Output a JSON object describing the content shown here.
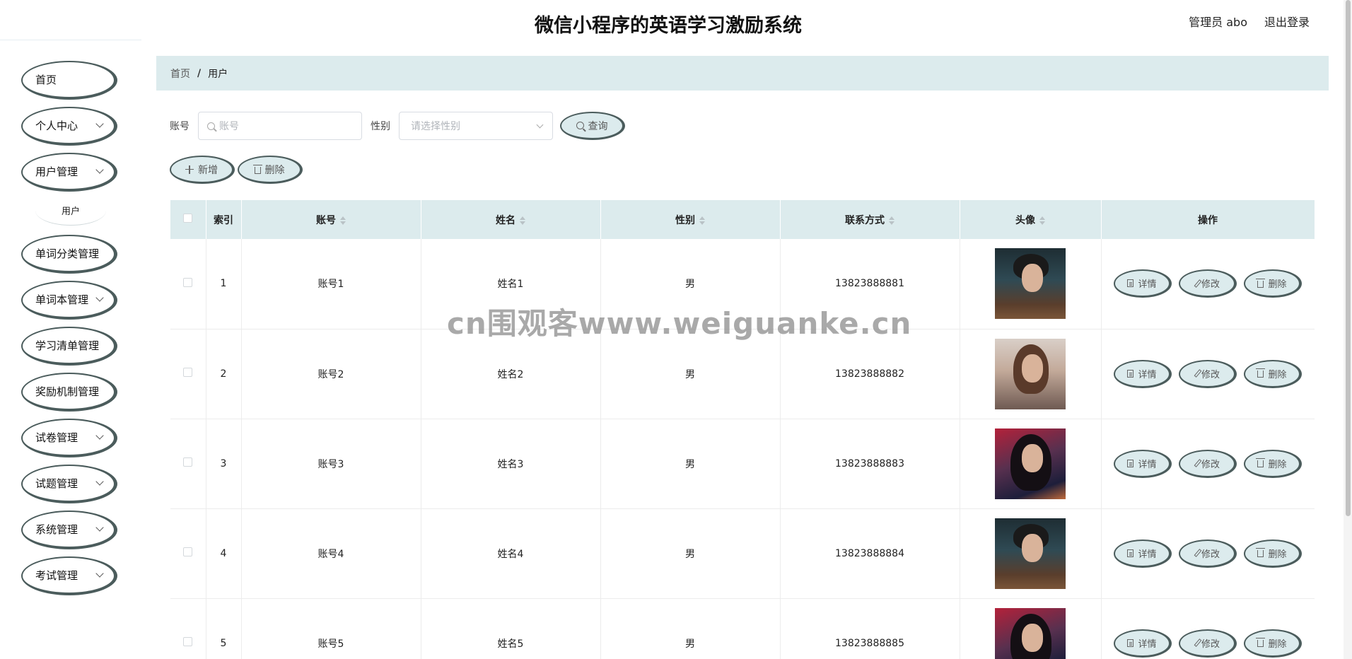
{
  "header": {
    "title": "微信小程序的英语学习激励系统",
    "user_label": "管理员 abo",
    "logout": "退出登录"
  },
  "sidebar": {
    "items": [
      {
        "label": "首页",
        "has_chevron": false
      },
      {
        "label": "个人中心",
        "has_chevron": true
      },
      {
        "label": "用户管理",
        "has_chevron": true
      },
      {
        "label": "单词分类管理",
        "has_chevron": false
      },
      {
        "label": "单词本管理",
        "has_chevron": true
      },
      {
        "label": "学习清单管理",
        "has_chevron": false
      },
      {
        "label": "奖励机制管理",
        "has_chevron": false
      },
      {
        "label": "试卷管理",
        "has_chevron": true
      },
      {
        "label": "试题管理",
        "has_chevron": true
      },
      {
        "label": "系统管理",
        "has_chevron": true
      },
      {
        "label": "考试管理",
        "has_chevron": true
      }
    ],
    "sub_item": "用户"
  },
  "breadcrumb": {
    "home": "首页",
    "separator": "/",
    "current": "用户"
  },
  "search": {
    "account_label": "账号",
    "account_placeholder": "账号",
    "gender_label": "性别",
    "gender_placeholder": "请选择性别",
    "query_button": "查询"
  },
  "actions": {
    "add": "新增",
    "delete": "删除"
  },
  "table": {
    "columns": [
      "索引",
      "账号",
      "姓名",
      "性别",
      "联系方式",
      "头像",
      "操作"
    ],
    "rows": [
      {
        "index": "1",
        "account": "账号1",
        "name": "姓名1",
        "gender": "男",
        "phone": "13823888881",
        "avatar": "male"
      },
      {
        "index": "2",
        "account": "账号2",
        "name": "姓名2",
        "gender": "男",
        "phone": "13823888882",
        "avatar": "female-a"
      },
      {
        "index": "3",
        "account": "账号3",
        "name": "姓名3",
        "gender": "男",
        "phone": "13823888883",
        "avatar": "female-b"
      },
      {
        "index": "4",
        "account": "账号4",
        "name": "姓名4",
        "gender": "男",
        "phone": "13823888884",
        "avatar": "male"
      },
      {
        "index": "5",
        "account": "账号5",
        "name": "姓名5",
        "gender": "男",
        "phone": "13823888885",
        "avatar": "female-b"
      }
    ],
    "row_actions": {
      "detail": "详情",
      "edit": "修改",
      "delete": "删除"
    }
  },
  "watermark": "cn围观客www.weiguanke.cn",
  "colors": {
    "accent": "#dcebed",
    "border": "#4b5c5c"
  }
}
